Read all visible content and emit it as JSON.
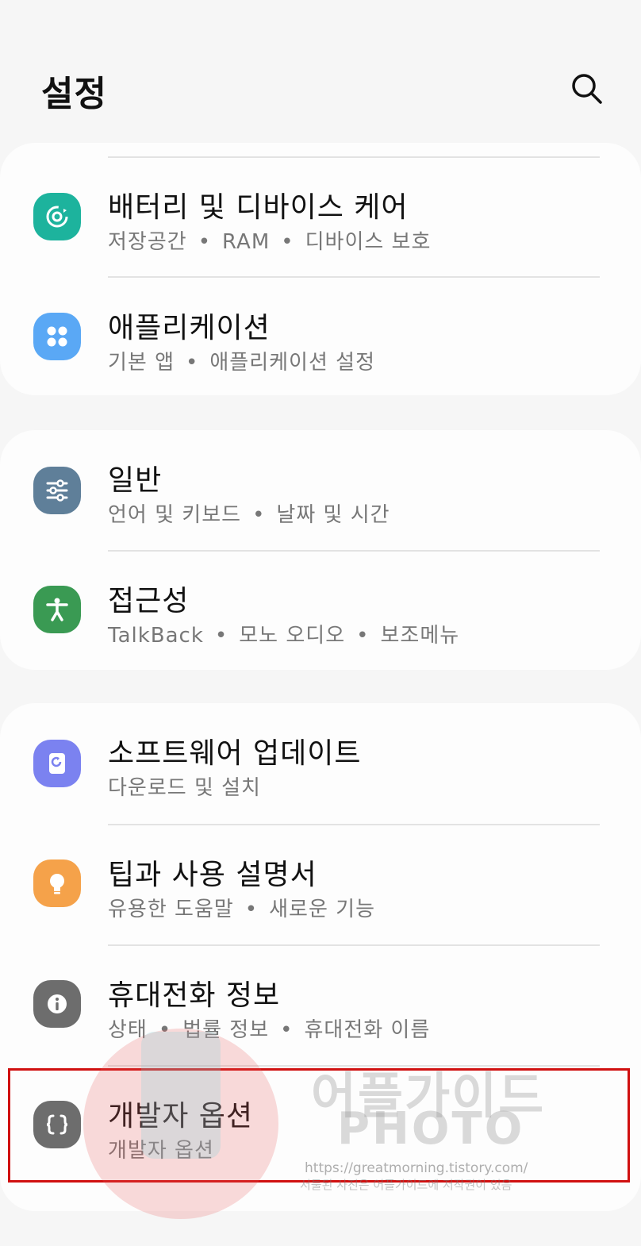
{
  "header": {
    "title": "설정"
  },
  "groups": [
    {
      "items": [
        {
          "title": "배터리 및 디바이스 케어",
          "subtitle": [
            "저장공간",
            "RAM",
            "디바이스 보호"
          ],
          "icon": "device-care-icon",
          "color": "#1db39d"
        },
        {
          "title": "애플리케이션",
          "subtitle": [
            "기본 앱",
            "애플리케이션 설정"
          ],
          "icon": "apps-icon",
          "color": "#5aa8f5"
        }
      ]
    },
    {
      "items": [
        {
          "title": "일반",
          "subtitle": [
            "언어 및 키보드",
            "날짜 및 시간"
          ],
          "icon": "sliders-icon",
          "color": "#5f7f99"
        },
        {
          "title": "접근성",
          "subtitle": [
            "TalkBack",
            "모노 오디오",
            "보조메뉴"
          ],
          "icon": "accessibility-icon",
          "color": "#3a9a53"
        }
      ]
    },
    {
      "items": [
        {
          "title": "소프트웨어 업데이트",
          "subtitle": [
            "다운로드 및 설치"
          ],
          "icon": "software-update-icon",
          "color": "#7b82f0"
        },
        {
          "title": "팁과 사용 설명서",
          "subtitle": [
            "유용한 도움말",
            "새로운 기능"
          ],
          "icon": "lightbulb-icon",
          "color": "#f5a24a"
        },
        {
          "title": "휴대전화 정보",
          "subtitle": [
            "상태",
            "법률 정보",
            "휴대전화 이름"
          ],
          "icon": "info-icon",
          "color": "#6d6d6d"
        },
        {
          "title": "개발자 옵션",
          "subtitle": [
            "개발자 옵션"
          ],
          "icon": "developer-braces-icon",
          "color": "#6d6d6d"
        }
      ]
    }
  ],
  "subtitle_separator": "•",
  "watermark": {
    "line1": "어플가이드",
    "line2": "PHOTO",
    "url": "https://greatmorning.tistory.com/",
    "notice": "서툴된 사진은 어플가이드에 저작권이 있음"
  }
}
